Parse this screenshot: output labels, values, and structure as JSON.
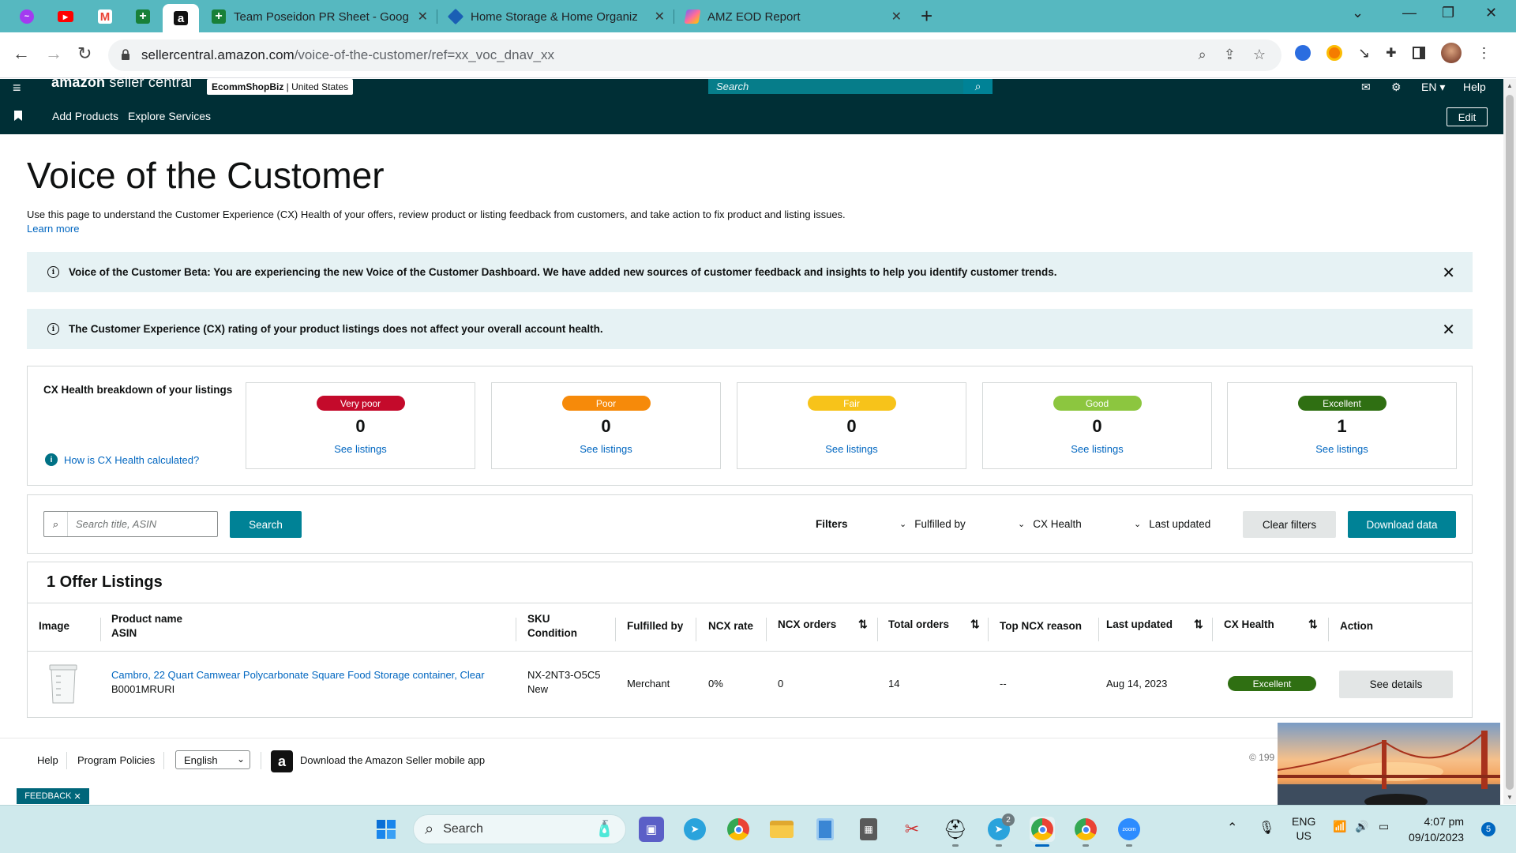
{
  "browser": {
    "pinned_tabs": [
      {
        "name": "messenger",
        "color": "#a33bf0"
      },
      {
        "name": "youtube",
        "color": "#ff0000"
      },
      {
        "name": "gmail",
        "color": "#ea4335"
      },
      {
        "name": "sheets",
        "color": "#188038"
      },
      {
        "name": "amazon",
        "color": "#111111"
      }
    ],
    "tabs": [
      {
        "title": "Team Poseidon PR Sheet - Goog",
        "icon": "sheets-icon",
        "color": "#188038"
      },
      {
        "title": "Home Storage & Home Organiz",
        "icon": "diamond-icon",
        "color": "#1a5fb4"
      },
      {
        "title": "AMZ EOD Report",
        "icon": "clickup-icon",
        "color": "#7b68ee"
      }
    ],
    "url_host": "sellercentral.amazon.com",
    "url_path": "/voice-of-the-customer/ref=xx_voc_dnav_xx"
  },
  "header": {
    "logo_bold": "amazon",
    "logo_light": " seller central",
    "account_bold": "EcommShopBiz",
    "account_region": " | United States",
    "search_placeholder": "Search",
    "language": "EN",
    "help": "Help",
    "nav_links": [
      "Add Products",
      "Explore Services"
    ],
    "edit": "Edit"
  },
  "main": {
    "title": "Voice of the Customer",
    "description": "Use this page to understand the Customer Experience (CX) Health of your offers, review product or listing feedback from customers, and take action to fix product and listing issues.",
    "learn_more": "Learn more",
    "banners": [
      "Voice of the Customer Beta: You are experiencing the new Voice of the Customer Dashboard. We have added new sources of customer feedback and insights to help you identify customer trends.",
      "The Customer Experience (CX) rating of your product listings does not affect your overall account health."
    ],
    "cx_breakdown": {
      "label": "CX Health breakdown of your listings",
      "how_link": "How is CX Health calculated?",
      "cards": [
        {
          "status": "Very poor",
          "count": "0",
          "link": "See listings",
          "color": "#c40a2b"
        },
        {
          "status": "Poor",
          "count": "0",
          "link": "See listings",
          "color": "#f68a0a"
        },
        {
          "status": "Fair",
          "count": "0",
          "link": "See listings",
          "color": "#f7c31a"
        },
        {
          "status": "Good",
          "count": "0",
          "link": "See listings",
          "color": "#8cc63f"
        },
        {
          "status": "Excellent",
          "count": "1",
          "link": "See listings",
          "color": "#2f6f12"
        }
      ]
    },
    "filters": {
      "search_placeholder": "Search title, ASIN",
      "search_button": "Search",
      "filters_label": "Filters",
      "dropdowns": [
        "Fulfilled by",
        "CX Health",
        "Last updated"
      ],
      "clear": "Clear filters",
      "download": "Download data"
    },
    "table": {
      "heading": "1 Offer Listings",
      "headers": {
        "image": "Image",
        "product": "Product name",
        "asin": "ASIN",
        "sku": "SKU",
        "condition": "Condition",
        "fulfilled": "Fulfilled by",
        "ncx_rate": "NCX rate",
        "ncx_orders": "NCX orders",
        "total_orders": "Total orders",
        "top_reason": "Top NCX reason",
        "last_updated": "Last updated",
        "cx_health": "CX Health",
        "action": "Action"
      },
      "rows": [
        {
          "product": "Cambro, 22 Quart Camwear Polycarbonate Square Food Storage container, Clear",
          "asin": "B0001MRURI",
          "sku": "NX-2NT3-O5C5",
          "condition": "New",
          "fulfilled": "Merchant",
          "ncx_rate": "0%",
          "ncx_orders": "0",
          "total_orders": "14",
          "top_reason": "--",
          "last_updated": "Aug 14, 2023",
          "cx_health": "Excellent",
          "action": "See details"
        }
      ]
    }
  },
  "footer": {
    "help": "Help",
    "policies": "Program Policies",
    "language": "English",
    "app_text": "Download the Amazon Seller mobile app",
    "copyright": "© 199",
    "feedback": "FEEDBACK"
  },
  "taskbar": {
    "search": "Search",
    "lang_1": "ENG",
    "lang_2": "US",
    "time": "4:07 pm",
    "date": "09/10/2023",
    "notif_count": "5",
    "telegram_badge": "2"
  }
}
